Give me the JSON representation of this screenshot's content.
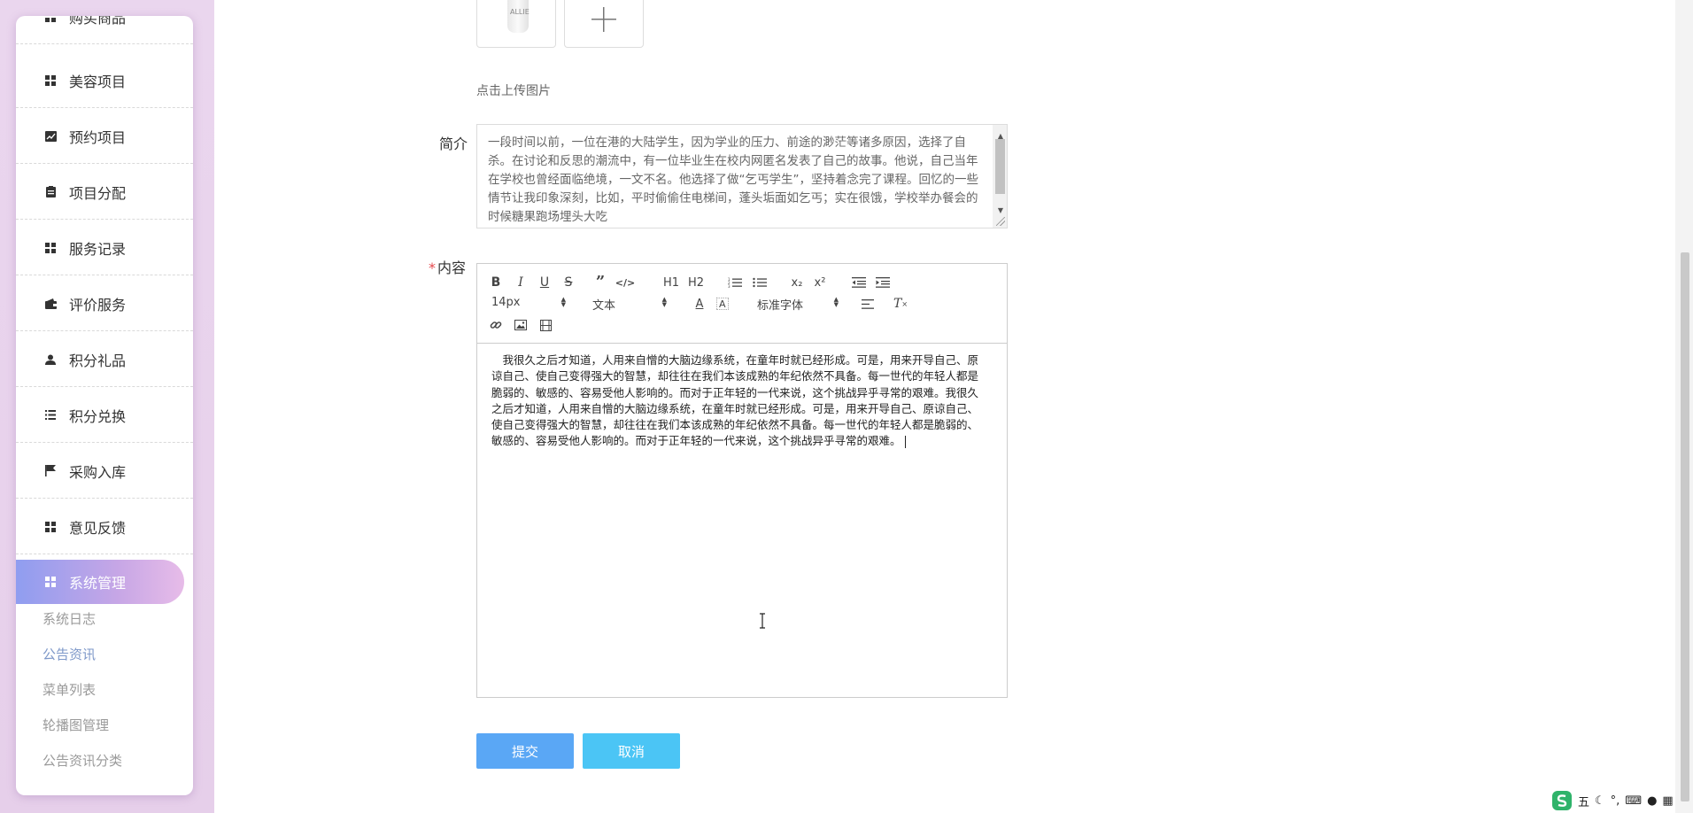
{
  "sidebar": {
    "items": [
      {
        "label": "购买商品",
        "icon": "grid-icon"
      },
      {
        "label": "美容项目",
        "icon": "grid-icon"
      },
      {
        "label": "预约项目",
        "icon": "chart-icon"
      },
      {
        "label": "项目分配",
        "icon": "clipboard-icon"
      },
      {
        "label": "服务记录",
        "icon": "grid-icon"
      },
      {
        "label": "评价服务",
        "icon": "wallet-icon"
      },
      {
        "label": "积分礼品",
        "icon": "user-icon"
      },
      {
        "label": "积分兑换",
        "icon": "list-icon"
      },
      {
        "label": "采购入库",
        "icon": "flag-icon"
      },
      {
        "label": "意见反馈",
        "icon": "grid-icon"
      },
      {
        "label": "系统管理",
        "icon": "grid-icon",
        "active": true
      }
    ],
    "sub_items": [
      "系统日志",
      "公告资讯",
      "菜单列表",
      "轮播图管理",
      "公告资讯分类"
    ],
    "current_sub": "公告资讯"
  },
  "upload": {
    "thumb_text": "ALLIE",
    "hint": "点击上传图片"
  },
  "form": {
    "intro_label": "简介",
    "intro_text": "一段时间以前，一位在港的大陆学生，因为学业的压力、前途的渺茫等诸多原因，选择了自杀。在讨论和反思的潮流中，有一位毕业生在校内网匿名发表了自己的故事。他说，自己当年在学校也曾经面临绝境，一文不名。他选择了做“乞丐学生”，坚持着念完了课程。回忆的一些情节让我印象深刻，比如，平时偷偷住电梯间，蓬头垢面如乞丐；实在很饿，学校举办餐会的时候糖果跑场埋头大吃",
    "content_label": "内容",
    "content_text": "　我很久之后才知道，人用来自憎的大脑边缘系统，在童年时就已经形成。可是，用来开导自己、原谅自己、使自己变得强大的智慧，却往往在我们本该成熟的年纪依然不具备。每一世代的年轻人都是脆弱的、敏感的、容易受他人影响的。而对于正年轻的一代来说，这个挑战异乎寻常的艰难。我很久之后才知道，人用来自憎的大脑边缘系统，在童年时就已经形成。可是，用来开导自己、原谅自己、使自己变得强大的智慧，却往往在我们本该成熟的年纪依然不具备。每一世代的年轻人都是脆弱的、敏感的、容易受他人影响的。而对于正年轻的一代来说，这个挑战异乎寻常的艰难。",
    "submit_label": "提交",
    "cancel_label": "取消"
  },
  "toolbar": {
    "font_size": "14px",
    "block_format": "文本",
    "font_family": "标准字体",
    "h1": "H1",
    "h2": "H2",
    "subscript": "x₂",
    "superscript": "x²"
  },
  "tray": {
    "ime_mode": "五"
  },
  "colors": {
    "sidebar_active_start": "#8f9df0",
    "sidebar_active_end": "#e7bce8",
    "submit_button": "#5aa7f5",
    "cancel_button": "#4bc5f5",
    "required_star": "#e5484d"
  }
}
